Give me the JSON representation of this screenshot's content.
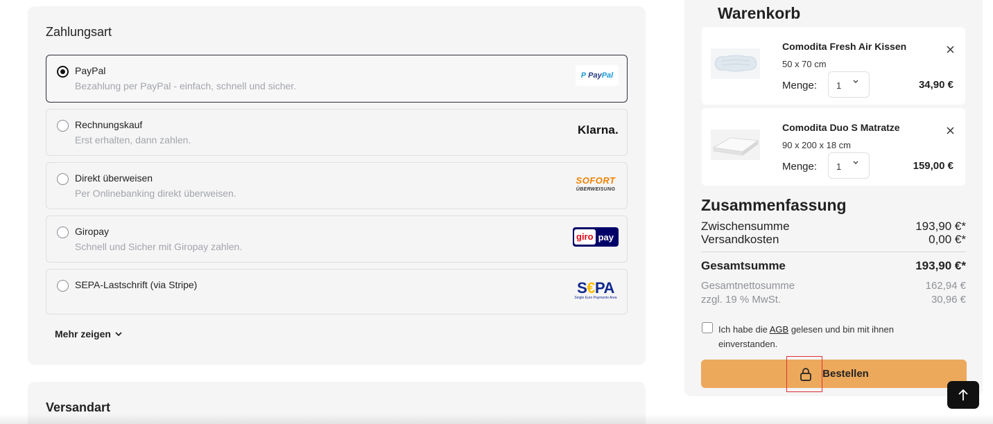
{
  "payment": {
    "title": "Zahlungsart",
    "options": [
      {
        "name": "PayPal",
        "desc": "Bezahlung per PayPal - einfach, schnell und sicher.",
        "selected": true,
        "logo": "paypal-logo"
      },
      {
        "name": "Rechnungskauf",
        "desc": "Erst erhalten, dann zahlen.",
        "selected": false,
        "logo": "klarna-logo"
      },
      {
        "name": "Direkt überweisen",
        "desc": "Per Onlinebanking direkt überweisen.",
        "selected": false,
        "logo": "sofort-logo"
      },
      {
        "name": "Giropay",
        "desc": "Schnell und Sicher mit Giropay zahlen.",
        "selected": false,
        "logo": "giropay-logo"
      },
      {
        "name": "SEPA-Lastschrift (via Stripe)",
        "desc": "",
        "selected": false,
        "logo": "sepa-logo"
      }
    ],
    "logos": {
      "paypal_pay": "Pay",
      "paypal_pal": "Pal",
      "klarna": "Klarna.",
      "sofort_1": "SOFORT",
      "sofort_2": "ÜBERWEISUNG",
      "giro_1": "giro",
      "giro_2": "pay",
      "sepa": "SEPA",
      "sepa_sub": "Single Euro Payments Area"
    },
    "more_label": "Mehr zeigen"
  },
  "shipping": {
    "title": "Versandart"
  },
  "cart": {
    "title": "Warenkorb",
    "items": [
      {
        "name": "Comodita Fresh Air Kissen",
        "size": "50 x 70 cm",
        "qty_label": "Menge:",
        "qty": "1",
        "price": "34,90 €"
      },
      {
        "name": "Comodita Duo S Matratze",
        "size": "90 x 200 x 18 cm",
        "qty_label": "Menge:",
        "qty": "1",
        "price": "159,00 €"
      }
    ]
  },
  "summary": {
    "title": "Zusammenfassung",
    "subtotal_label": "Zwischensumme",
    "subtotal": "193,90 €*",
    "shipping_label": "Versandkosten",
    "shipping": "0,00 €*",
    "total_label": "Gesamtsumme",
    "total": "193,90 €*",
    "net_label": "Gesamtnettosumme",
    "net": "162,94 €",
    "vat_label": "zzgl. 19 % MwSt.",
    "vat": "30,96 €"
  },
  "agb": {
    "pre": "Ich habe die ",
    "link": "AGB",
    "post": " gelesen und bin mit ihnen einverstanden."
  },
  "order_button": {
    "label": "Bestellen"
  },
  "colors": {
    "accent": "#eca95c",
    "panel": "#f5f5f6",
    "highlight": "#e03030"
  }
}
